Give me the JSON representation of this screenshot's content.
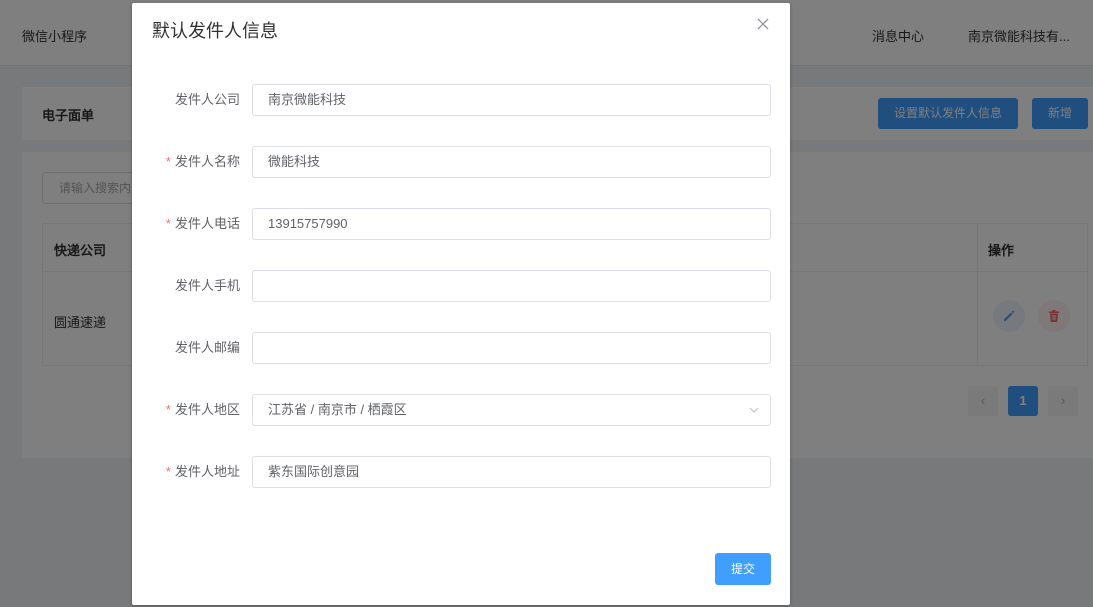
{
  "topbar": {
    "app_title": "微信小程序",
    "message_center": "消息中心",
    "company": "南京微能科技有..."
  },
  "page": {
    "card_title": "电子面单",
    "set_default_button": "设置默认发件人信息",
    "add_button": "新增",
    "search_placeholder": "请输入搜索内",
    "table": {
      "columns": [
        "快递公司",
        "操作"
      ],
      "rows": [
        {
          "company": "圆通速递"
        }
      ]
    },
    "pagination": {
      "prev": "‹",
      "current": "1",
      "next": "›"
    }
  },
  "dialog": {
    "title": "默认发件人信息",
    "close_icon": "close-icon",
    "fields": {
      "company": {
        "label": "发件人公司",
        "required": false,
        "value": "南京微能科技"
      },
      "name": {
        "label": "发件人名称",
        "required": true,
        "value": "微能科技"
      },
      "phone": {
        "label": "发件人电话",
        "required": true,
        "value": "13915757990"
      },
      "mobile": {
        "label": "发件人手机",
        "required": false,
        "value": ""
      },
      "postcode": {
        "label": "发件人邮编",
        "required": false,
        "value": ""
      },
      "region": {
        "label": "发件人地区",
        "required": true,
        "value": "江苏省 / 南京市 / 栖霞区"
      },
      "address": {
        "label": "发件人地址",
        "required": true,
        "value": "紫东国际创意园"
      }
    },
    "required_mark": "*",
    "submit_button": "提交"
  },
  "colors": {
    "primary": "#409eff",
    "danger": "#f56c6c",
    "overlay": "rgba(0,0,0,0.5)"
  }
}
